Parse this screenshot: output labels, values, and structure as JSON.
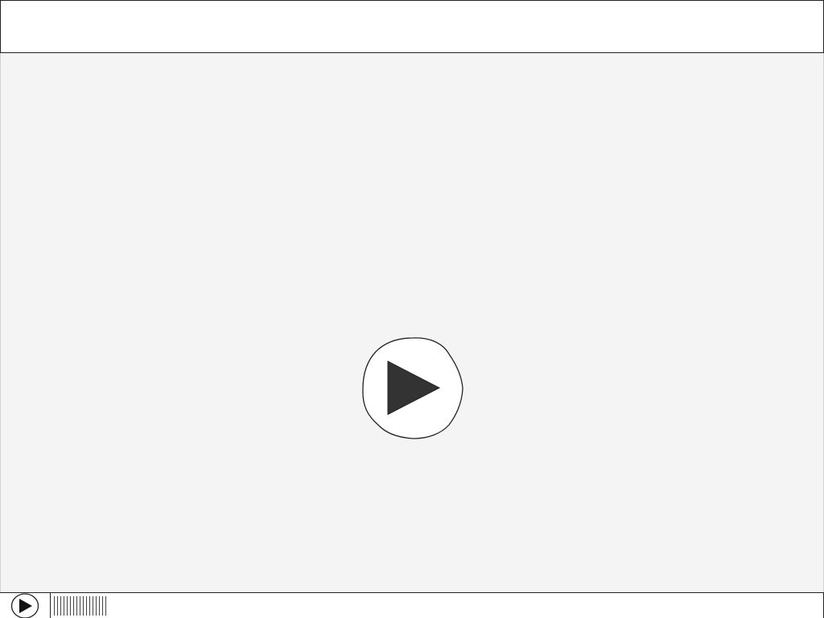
{
  "app": {
    "title": ""
  },
  "player": {
    "big_play_icon": "play-circle-icon",
    "small_play_icon": "play-circle-icon",
    "progress_buffered_fraction": 0.07,
    "progress_played_fraction": 0.0,
    "colors": {
      "background": "#f4f4f4",
      "icon_fill": "#333333",
      "outline": "#222222"
    }
  }
}
